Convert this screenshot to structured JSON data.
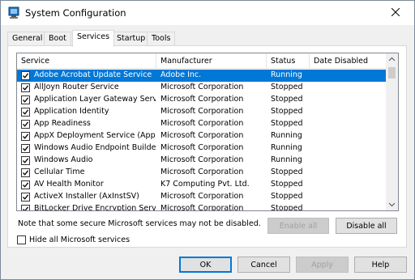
{
  "window": {
    "title": "System Configuration"
  },
  "tabs": [
    {
      "label": "General",
      "active": false
    },
    {
      "label": "Boot",
      "active": false
    },
    {
      "label": "Services",
      "active": true
    },
    {
      "label": "Startup",
      "active": false
    },
    {
      "label": "Tools",
      "active": false
    }
  ],
  "table": {
    "columns": [
      "Service",
      "Manufacturer",
      "Status",
      "Date Disabled"
    ],
    "rows": [
      {
        "checked": true,
        "service": "Adobe Acrobat Update Service",
        "manufacturer": "Adobe Inc.",
        "status": "Running",
        "date": "",
        "selected": true
      },
      {
        "checked": true,
        "service": "AllJoyn Router Service",
        "manufacturer": "Microsoft Corporation",
        "status": "Stopped",
        "date": ""
      },
      {
        "checked": true,
        "service": "Application Layer Gateway Service",
        "manufacturer": "Microsoft Corporation",
        "status": "Stopped",
        "date": ""
      },
      {
        "checked": true,
        "service": "Application Identity",
        "manufacturer": "Microsoft Corporation",
        "status": "Stopped",
        "date": ""
      },
      {
        "checked": true,
        "service": "App Readiness",
        "manufacturer": "Microsoft Corporation",
        "status": "Stopped",
        "date": ""
      },
      {
        "checked": true,
        "service": "AppX Deployment Service (AppX...",
        "manufacturer": "Microsoft Corporation",
        "status": "Running",
        "date": ""
      },
      {
        "checked": true,
        "service": "Windows Audio Endpoint Builder",
        "manufacturer": "Microsoft Corporation",
        "status": "Running",
        "date": ""
      },
      {
        "checked": true,
        "service": "Windows Audio",
        "manufacturer": "Microsoft Corporation",
        "status": "Running",
        "date": ""
      },
      {
        "checked": true,
        "service": "Cellular Time",
        "manufacturer": "Microsoft Corporation",
        "status": "Stopped",
        "date": ""
      },
      {
        "checked": true,
        "service": "AV Health Monitor",
        "manufacturer": "K7 Computing Pvt. Ltd.",
        "status": "Stopped",
        "date": ""
      },
      {
        "checked": true,
        "service": "ActiveX Installer (AxInstSV)",
        "manufacturer": "Microsoft Corporation",
        "status": "Stopped",
        "date": ""
      },
      {
        "checked": true,
        "service": "BitLocker Drive Encryption Service",
        "manufacturer": "Microsoft Corporation",
        "status": "Stopped",
        "date": ""
      }
    ]
  },
  "note": "Note that some secure Microsoft services may not be disabled.",
  "buttons": {
    "enable_all": "Enable all",
    "disable_all": "Disable all",
    "ok": "OK",
    "cancel": "Cancel",
    "apply": "Apply",
    "help": "Help"
  },
  "hide_ms": {
    "label": "Hide all Microsoft services",
    "checked": false
  },
  "colors": {
    "selection": "#0078d7"
  }
}
